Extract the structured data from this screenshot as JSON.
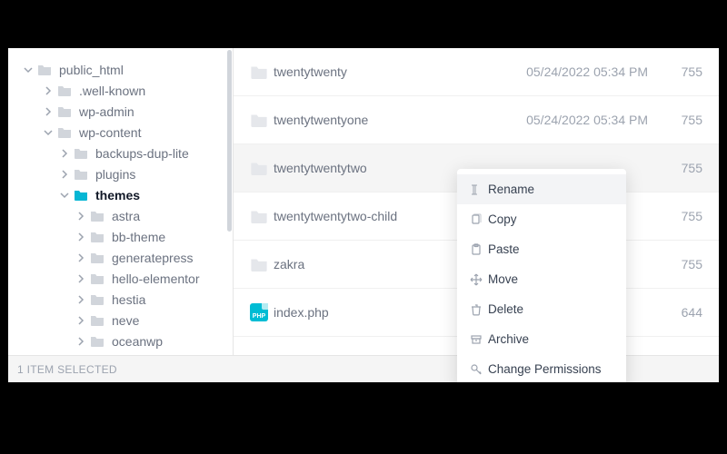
{
  "tree": {
    "root": "public_html",
    "c1": ".well-known",
    "c2": "wp-admin",
    "c3": "wp-content",
    "t1": "backups-dup-lite",
    "t2": "plugins",
    "t3": "themes",
    "th1": "astra",
    "th2": "bb-theme",
    "th3": "generatepress",
    "th4": "hello-elementor",
    "th5": "hestia",
    "th6": "neve",
    "th7": "oceanwp"
  },
  "files": [
    {
      "name": "twentytwenty",
      "date": "05/24/2022 05:34 PM",
      "perm": "755",
      "type": "folder"
    },
    {
      "name": "twentytwentyone",
      "date": "05/24/2022 05:34 PM",
      "perm": "755",
      "type": "folder"
    },
    {
      "name": "twentytwentytwo",
      "date": "",
      "perm": "755",
      "type": "folder",
      "selected": true
    },
    {
      "name": "twentytwentytwo-child",
      "date": "",
      "perm": "755",
      "type": "folder"
    },
    {
      "name": "zakra",
      "date": "",
      "perm": "755",
      "type": "folder"
    },
    {
      "name": "index.php",
      "date": "",
      "perm": "644",
      "type": "php"
    }
  ],
  "status": "1 ITEM SELECTED",
  "ctx": {
    "rename": "Rename",
    "copy": "Copy",
    "paste": "Paste",
    "move": "Move",
    "delete": "Delete",
    "archive": "Archive",
    "chmod": "Change Permissions"
  }
}
